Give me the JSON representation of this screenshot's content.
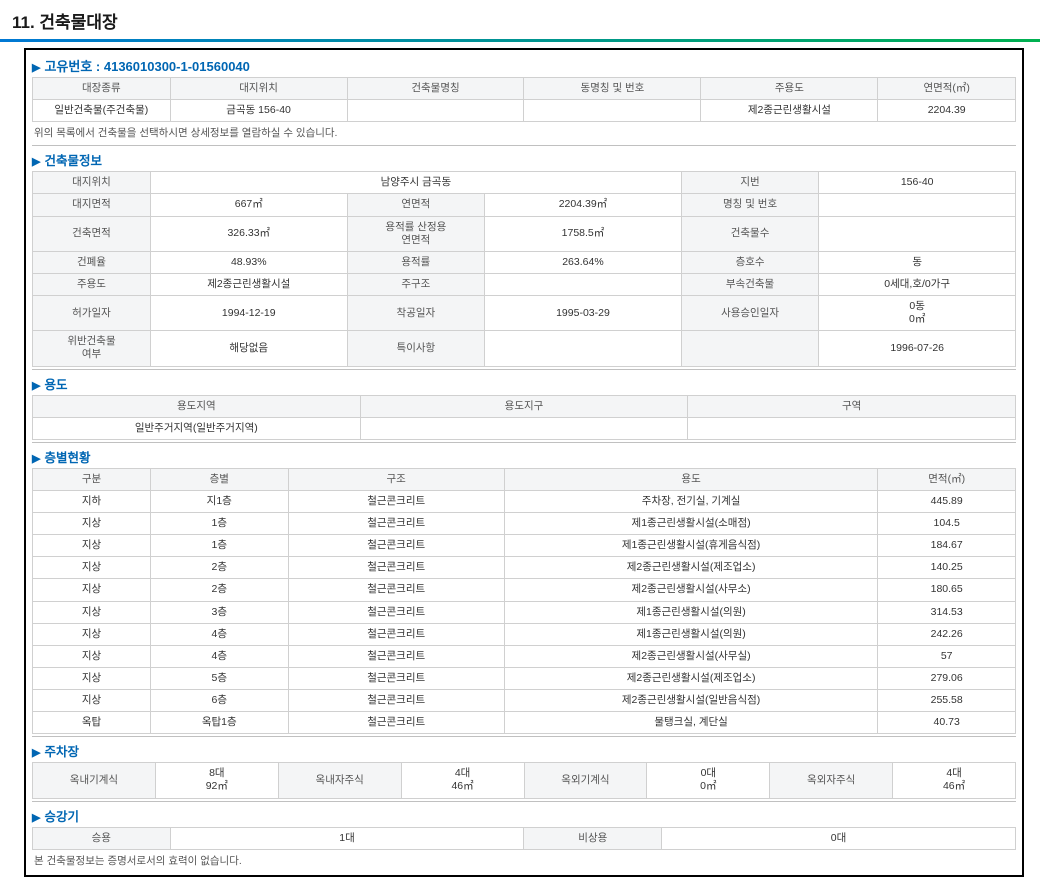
{
  "pageTitle": "11. 건축물대장",
  "uniqueNo": "고유번호 : 4136010300-1-01560040",
  "summary": {
    "headers": [
      "대장종류",
      "대지위치",
      "건축물명칭",
      "동명칭 및 번호",
      "주용도",
      "연면적(㎡)"
    ],
    "row": [
      "일반건축물(주건축물)",
      "금곡동 156-40",
      "",
      "",
      "제2종근린생활시설",
      "2204.39"
    ]
  },
  "noteTop": "위의 목록에서 건축물을 선택하시면 상세정보를 열람하실 수 있습니다.",
  "info": {
    "title": "건축물정보",
    "rows": [
      [
        "대지위치",
        "",
        "남양주시 금곡동",
        "",
        "지번",
        "156-40"
      ],
      [
        "대지면적",
        "667㎡",
        "연면적",
        "2204.39㎡",
        "명칭 및 번호",
        ""
      ],
      [
        "건축면적",
        "326.33㎡",
        "용적률 산정용\n연면적",
        "1758.5㎡",
        "건축물수",
        ""
      ],
      [
        "건폐율",
        "48.93%",
        "용적률",
        "263.64%",
        "층호수",
        "동"
      ],
      [
        "주용도",
        "제2종근린생활시설",
        "주구조",
        "",
        "부속건축물",
        "0세대,호/0가구"
      ],
      [
        "허가일자",
        "1994-12-19",
        "착공일자",
        "1995-03-29",
        "사용승인일자",
        "0동\n0㎡"
      ],
      [
        "위반건축물\n여부",
        "해당없음",
        "특이사항",
        "",
        "",
        "1996-07-26"
      ]
    ]
  },
  "usage": {
    "title": "용도",
    "headers": [
      "용도지역",
      "용도지구",
      "구역"
    ],
    "row": [
      "일반주거지역(일반주거지역)",
      "",
      ""
    ]
  },
  "floors": {
    "title": "층별현황",
    "headers": [
      "구분",
      "층별",
      "구조",
      "용도",
      "면적(㎡)"
    ],
    "rows": [
      [
        "지하",
        "지1층",
        "철근콘크리트",
        "주차장, 전기실, 기계실",
        "445.89"
      ],
      [
        "지상",
        "1층",
        "철근콘크리트",
        "제1종근린생활시설(소매점)",
        "104.5"
      ],
      [
        "지상",
        "1층",
        "철근콘크리트",
        "제1종근린생활시설(휴게음식점)",
        "184.67"
      ],
      [
        "지상",
        "2층",
        "철근콘크리트",
        "제2종근린생활시설(제조업소)",
        "140.25"
      ],
      [
        "지상",
        "2층",
        "철근콘크리트",
        "제2종근린생활시설(사무소)",
        "180.65"
      ],
      [
        "지상",
        "3층",
        "철근콘크리트",
        "제1종근린생활시설(의원)",
        "314.53"
      ],
      [
        "지상",
        "4층",
        "철근콘크리트",
        "제1종근린생활시설(의원)",
        "242.26"
      ],
      [
        "지상",
        "4층",
        "철근콘크리트",
        "제2종근린생활시설(사무실)",
        "57"
      ],
      [
        "지상",
        "5층",
        "철근콘크리트",
        "제2종근린생활시설(제조업소)",
        "279.06"
      ],
      [
        "지상",
        "6층",
        "철근콘크리트",
        "제2종근린생활시설(일반음식점)",
        "255.58"
      ],
      [
        "옥탑",
        "옥탑1층",
        "철근콘크리트",
        "물탱크실, 계단실",
        "40.73"
      ]
    ]
  },
  "parking": {
    "title": "주차장",
    "cells": [
      "옥내기계식",
      "8대\n92㎡",
      "옥내자주식",
      "4대\n46㎡",
      "옥외기계식",
      "0대\n0㎡",
      "옥외자주식",
      "4대\n46㎡"
    ]
  },
  "elevator": {
    "title": "승강기",
    "cells": [
      "승용",
      "1대",
      "비상용",
      "0대"
    ]
  },
  "footer": "본 건축물정보는 증명서로서의 효력이 없습니다."
}
